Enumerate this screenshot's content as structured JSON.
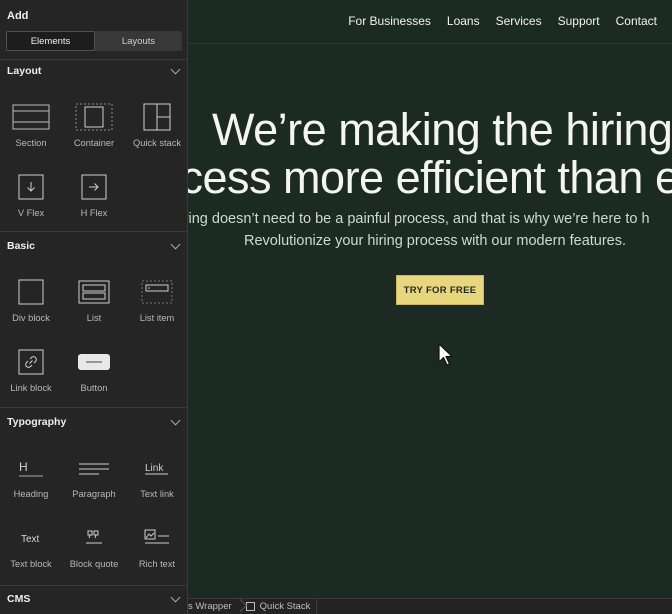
{
  "panel": {
    "title": "Add",
    "tabs": [
      "Elements",
      "Layouts"
    ],
    "sections": {
      "layout": {
        "title": "Layout",
        "items": [
          "Section",
          "Container",
          "Quick stack",
          "V Flex",
          "H Flex"
        ]
      },
      "basic": {
        "title": "Basic",
        "items": [
          "Div block",
          "List",
          "List item",
          "Link block",
          "Button"
        ]
      },
      "typography": {
        "title": "Typography",
        "items": [
          "Heading",
          "Paragraph",
          "Text link",
          "Text block",
          "Block quote",
          "Rich text"
        ]
      },
      "cms": {
        "title": "CMS"
      }
    },
    "icon_text": {
      "heading": "H",
      "text_link": "Link",
      "text": "Text"
    }
  },
  "site": {
    "nav": [
      "For Businesses",
      "Loans",
      "Services",
      "Support",
      "Contact"
    ],
    "hero_line1": "We’re making the hiring",
    "hero_line2": "ocess more efficient than e",
    "sub_line1": "Hiring doesn’t need to be a painful process, and that is why we’re here to h",
    "sub_line2": "Revolutionize your hiring process with our modern features.",
    "cta": "TRY FOR FREE"
  },
  "breadcrumbs": [
    "s Wrapper",
    "Quick Stack"
  ],
  "colors": {
    "canvas_bg": "#1b2b23",
    "panel_bg": "#252525",
    "cta_bg": "#e8d67c"
  }
}
